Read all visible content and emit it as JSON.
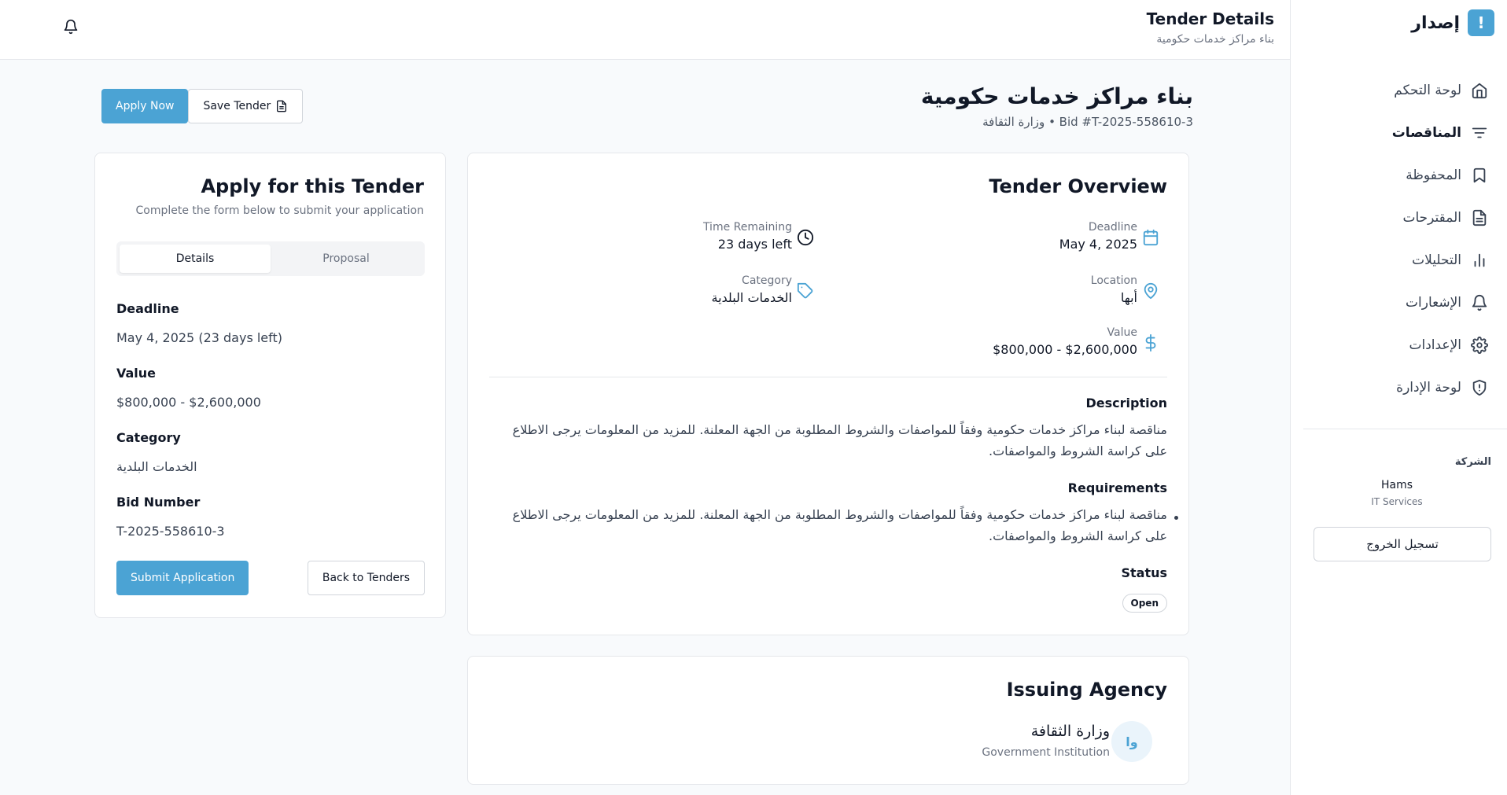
{
  "brand": {
    "name": "إصدار",
    "logo_glyph": "!"
  },
  "sidebar": {
    "items": [
      {
        "label": "لوحة التحكم",
        "icon": "home-icon"
      },
      {
        "label": "المناقصات",
        "icon": "filter-icon",
        "active": true
      },
      {
        "label": "المحفوظة",
        "icon": "bookmark-icon"
      },
      {
        "label": "المقترحات",
        "icon": "file-icon"
      },
      {
        "label": "التحليلات",
        "icon": "chart-icon"
      },
      {
        "label": "الإشعارات",
        "icon": "bell-icon"
      },
      {
        "label": "الإعدادات",
        "icon": "gear-icon"
      },
      {
        "label": "لوحة الإدارة",
        "icon": "shield-icon"
      }
    ],
    "company_label": "الشركة",
    "company_name": "Hams",
    "company_type": "IT Services",
    "logout_label": "تسجيل الخروج"
  },
  "header": {
    "title": "Tender Details",
    "subtitle": "بناء مراكز خدمات حكومية"
  },
  "page": {
    "title": "بناء مراكز خدمات حكومية",
    "subtitle": "وزارة الثقافة • Bid #T-2025-558610-3",
    "apply_now_label": "Apply Now",
    "save_tender_label": "Save Tender"
  },
  "apply": {
    "title": "Apply for this Tender",
    "subtitle": "Complete the form below to submit your application",
    "tabs": [
      "Details",
      "Proposal"
    ],
    "fields": [
      {
        "label": "Deadline",
        "value": "May 4, 2025 (23 days left)"
      },
      {
        "label": "Value",
        "value": "$800,000 - $2,600,000"
      },
      {
        "label": "Category",
        "value": "الخدمات البلدية"
      },
      {
        "label": "Bid Number",
        "value": "T-2025-558610-3"
      }
    ],
    "submit_label": "Submit Application",
    "back_label": "Back to Tenders"
  },
  "overview": {
    "title": "Tender Overview",
    "deadline_label": "Deadline",
    "deadline_value": "May 4, 2025",
    "time_label": "Time Remaining",
    "time_value": "23 days left",
    "location_label": "Location",
    "location_value": "أبها",
    "category_label": "Category",
    "category_value": "الخدمات البلدية",
    "value_label": "Value",
    "value_value": "$800,000 - $2,600,000",
    "description_title": "Description",
    "description_text": "مناقصة لبناء مراكز خدمات حكومية وفقاً للمواصفات والشروط المطلوبة من الجهة المعلنة. للمزيد من المعلومات يرجى الاطلاع على كراسة الشروط والمواصفات.",
    "requirements_title": "Requirements",
    "requirements_text": "مناقصة لبناء مراكز خدمات حكومية وفقاً للمواصفات والشروط المطلوبة من الجهة المعلنة. للمزيد من المعلومات يرجى الاطلاع على كراسة الشروط والمواصفات.",
    "status_title": "Status",
    "status_value": "Open"
  },
  "agency": {
    "title": "Issuing Agency",
    "avatar": "وا",
    "name": "وزارة الثقافة",
    "type": "Government Institution"
  },
  "colors": {
    "accent": "#4ba3d4"
  }
}
